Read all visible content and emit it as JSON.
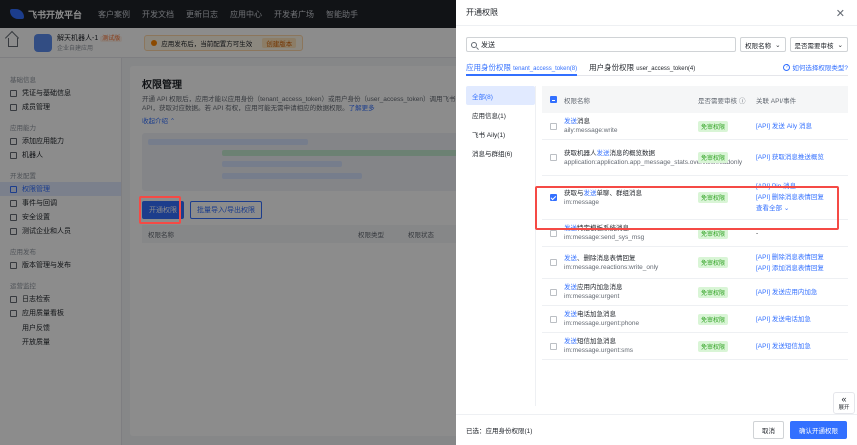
{
  "topbar": {
    "brand": "飞书开放平台",
    "nav": [
      "客户案例",
      "开发文档",
      "更新日志",
      "应用中心",
      "开发者广场",
      "智能助手"
    ]
  },
  "subbar": {
    "app_name": "解天机器人-1",
    "app_badge": "测试版",
    "app_sub": "企业自建应用",
    "notice": "应用发布后，当前配置方可生效",
    "notice_btn": "创建版本"
  },
  "sidebar": {
    "groups": [
      {
        "title": "基础信息",
        "items": [
          {
            "label": "凭证与基础信息"
          },
          {
            "label": "成员管理"
          }
        ]
      },
      {
        "title": "应用能力",
        "items": [
          {
            "label": "添加应用能力"
          },
          {
            "label": "机器人"
          }
        ]
      },
      {
        "title": "开发配置",
        "items": [
          {
            "label": "权限管理",
            "active": true
          },
          {
            "label": "事件与回调"
          },
          {
            "label": "安全设置"
          },
          {
            "label": "测试企业和人员"
          }
        ]
      },
      {
        "title": "应用发布",
        "items": [
          {
            "label": "版本管理与发布"
          }
        ]
      },
      {
        "title": "运营监控",
        "items": [
          {
            "label": "日志检索"
          },
          {
            "label": "应用质量看板"
          }
        ]
      }
    ],
    "subitems": [
      "用户反馈",
      "开放质量"
    ]
  },
  "main": {
    "title": "权限管理",
    "desc": "开通 API 权限后，应用才能以应用身份（tenant_access_token）或用户身份（user_access_token）调用飞书 API，获取对应数据。若 API 有权，应用可能无需申请相应的数据权限。",
    "desc_link": "了解更多",
    "collapse": "收起介绍",
    "btn_open": "开通权限",
    "btn_batch": "批量导入/导出权限",
    "col_name": "权限名称",
    "col_type": "权限类型",
    "col_status": "权限状态"
  },
  "drawer": {
    "title": "开通权限",
    "search_value": "发送",
    "select_field": "权限名称",
    "select_audit": "是否需要审核",
    "tabs": [
      {
        "label": "应用身份权限",
        "sub": "tenant_access_token(8)"
      },
      {
        "label": "用户身份权限",
        "sub": "user_access_token(4)"
      }
    ],
    "help": "如何选择权限类型?",
    "categories": [
      "全部(8)",
      "应用信息(1)",
      "飞书 Aily(1)",
      "消息与群组(6)"
    ],
    "header": {
      "name": "权限名称",
      "audit": "是否需要审核",
      "api": "关联 API/事件"
    },
    "rows": [
      {
        "pre": "",
        "hit": "发送",
        "post": "消息",
        "code": "aily:message:write",
        "tag": "免审权限",
        "apis": [
          "[API] 发送 Aily 消息"
        ],
        "checked": false
      },
      {
        "pre": "获取机器人",
        "hit": "发送",
        "post": "消息的概览数据",
        "code": "application:application.app_message_stats.overview:readonly",
        "tag": "免审权限",
        "apis": [
          "[API] 获取消息推送概览"
        ],
        "checked": false
      },
      {
        "pre": "获取与",
        "hit": "发送",
        "post": "单聊、群组消息",
        "code": "im:message",
        "tag": "免审权限",
        "apis": [
          "[API] Pin 消息",
          "[API] 删除消息表情回复"
        ],
        "more": "查看全部",
        "checked": true
      },
      {
        "pre": "",
        "hit": "发送",
        "post": "特定模板系统消息",
        "code": "im:message:send_sys_msg",
        "tag": "免审权限",
        "apis": [
          "-"
        ],
        "checked": false
      },
      {
        "pre": "",
        "hit": "发送",
        "post": "、删除消息表情回复",
        "code": "im:message.reactions:write_only",
        "tag": "免审权限",
        "apis": [
          "[API] 删除消息表情回复",
          "[API] 添加消息表情回复"
        ],
        "checked": false
      },
      {
        "pre": "",
        "hit": "发送",
        "post": "应用内加急消息",
        "code": "im:message:urgent",
        "tag": "免审权限",
        "apis": [
          "[API] 发送应用内加急"
        ],
        "checked": false
      },
      {
        "pre": "",
        "hit": "发送",
        "post": "电话加急消息",
        "code": "im:message.urgent:phone",
        "tag": "免审权限",
        "apis": [
          "[API] 发送电话加急"
        ],
        "checked": false
      },
      {
        "pre": "",
        "hit": "发送",
        "post": "短信加急消息",
        "code": "im:message.urgent:sms",
        "tag": "免审权限",
        "apis": [
          "[API] 发送短信加急"
        ],
        "checked": false
      }
    ],
    "footer": {
      "selected_label": "已选：",
      "selected_value": "应用身份权限(1)",
      "cancel": "取消",
      "confirm": "确认开通权限"
    },
    "expand_label": "展开"
  },
  "colors": {
    "accent": "#3370ff",
    "highlight_box": "#f54a45",
    "tag_bg": "#d9f5d6",
    "tag_text": "#2ea121"
  }
}
